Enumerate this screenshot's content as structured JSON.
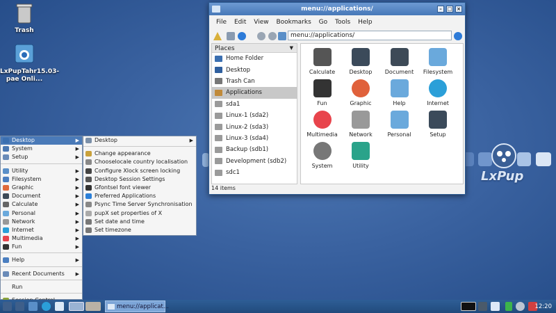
{
  "desktop": {
    "icons": [
      {
        "label": "Trash"
      },
      {
        "label": "LxPupTahr15.03-pae Onli..."
      }
    ],
    "logo_text": "LxPup"
  },
  "window": {
    "title": "menu://applications/",
    "menu": [
      "File",
      "Edit",
      "View",
      "Bookmarks",
      "Go",
      "Tools",
      "Help"
    ],
    "address": "menu://applications/",
    "places_header": "Places",
    "places": [
      {
        "label": "Home Folder",
        "color": "#3b6fb0"
      },
      {
        "label": "Desktop",
        "color": "#2f5f9e"
      },
      {
        "label": "Trash Can",
        "color": "#777777"
      },
      {
        "label": "Applications",
        "color": "#c08a3a",
        "selected": true
      },
      {
        "label": "sda1",
        "color": "#9a9a9a"
      },
      {
        "label": "Linux-1 (sda2)",
        "color": "#9a9a9a"
      },
      {
        "label": "Linux-2 (sda3)",
        "color": "#9a9a9a"
      },
      {
        "label": "Linux-3 (sda4)",
        "color": "#9a9a9a"
      },
      {
        "label": "Backup (sdb1)",
        "color": "#9a9a9a"
      },
      {
        "label": "Development (sdb2)",
        "color": "#9a9a9a"
      },
      {
        "label": "sdc1",
        "color": "#9a9a9a"
      }
    ],
    "apps": [
      {
        "label": "Calculate",
        "icon": "calculator-icon",
        "color": "#555555"
      },
      {
        "label": "Desktop",
        "icon": "sliders-icon",
        "color": "#3b4a5a"
      },
      {
        "label": "Document",
        "icon": "document-icon",
        "color": "#3d4a57"
      },
      {
        "label": "Filesystem",
        "icon": "folder-icon",
        "color": "#6aa9dc"
      },
      {
        "label": "Fun",
        "icon": "gamepad-icon",
        "color": "#333333"
      },
      {
        "label": "Graphic",
        "icon": "rainbow-icon",
        "color": "#e0613b"
      },
      {
        "label": "Help",
        "icon": "folder-icon",
        "color": "#6aa9dc"
      },
      {
        "label": "Internet",
        "icon": "globe-icon",
        "color": "#2b9fd8"
      },
      {
        "label": "Multimedia",
        "icon": "music-icon",
        "color": "#e8444c"
      },
      {
        "label": "Network",
        "icon": "wifi-icon",
        "color": "#999999"
      },
      {
        "label": "Personal",
        "icon": "folder-icon",
        "color": "#6aa9dc"
      },
      {
        "label": "Setup",
        "icon": "sliders-icon",
        "color": "#3b4a5a"
      },
      {
        "label": "System",
        "icon": "gear-icon",
        "color": "#777777"
      },
      {
        "label": "Utility",
        "icon": "tools-icon",
        "color": "#2aa38a"
      }
    ],
    "status": "14 items"
  },
  "start_menu": {
    "items": [
      {
        "label": "Desktop",
        "sub": true,
        "selected": true,
        "color": "#3b6fb0"
      },
      {
        "label": "System",
        "sub": true,
        "color": "#4b78b2"
      },
      {
        "label": "Setup",
        "sub": true,
        "color": "#6a8bb8"
      },
      {
        "label": "Utility",
        "sub": true,
        "color": "#5a8fc8"
      },
      {
        "label": "Filesystem",
        "sub": true,
        "color": "#4a7ec0"
      },
      {
        "label": "Graphic",
        "sub": true,
        "color": "#e06a3b"
      },
      {
        "label": "Document",
        "sub": true,
        "color": "#3d4a57"
      },
      {
        "label": "Calculate",
        "sub": true,
        "color": "#666666"
      },
      {
        "label": "Personal",
        "sub": true,
        "color": "#6aa9dc"
      },
      {
        "label": "Network",
        "sub": true,
        "color": "#999999"
      },
      {
        "label": "Internet",
        "sub": true,
        "color": "#2b9fd8"
      },
      {
        "label": "Multimedia",
        "sub": true,
        "color": "#e8444c"
      },
      {
        "label": "Fun",
        "sub": true,
        "color": "#333333"
      },
      {
        "label": "Help",
        "sub": true,
        "color": "#4a7ec0"
      },
      {
        "label": "Recent Documents",
        "sub": true,
        "color": "#6a8bb8"
      },
      {
        "label": "Run",
        "sub": false,
        "color": ""
      },
      {
        "label": "Session Control",
        "sub": false,
        "color": "#8aa23a"
      }
    ],
    "submenu": [
      {
        "label": "Desktop",
        "sub": true,
        "color": "#7a8fa8"
      },
      {
        "label": "Change appearance",
        "color": "#c9a13b"
      },
      {
        "label": "Chooselocale country localisation",
        "color": "#888888"
      },
      {
        "label": "Configure Xlock screen locking",
        "color": "#444444"
      },
      {
        "label": "Desktop Session Settings",
        "color": "#555555"
      },
      {
        "label": "Gfontsel font viewer",
        "color": "#333333"
      },
      {
        "label": "Preferred Applications",
        "color": "#2b7fd8"
      },
      {
        "label": "Psync Time Server Synchronisation",
        "color": "#888888"
      },
      {
        "label": "pupX set properties of X",
        "color": "#aaaaaa"
      },
      {
        "label": "Set date and time",
        "color": "#777777"
      },
      {
        "label": "Set timezone",
        "color": "#777777"
      }
    ]
  },
  "taskbar": {
    "task_label": "menu://applicat...",
    "clock": "12:20"
  }
}
